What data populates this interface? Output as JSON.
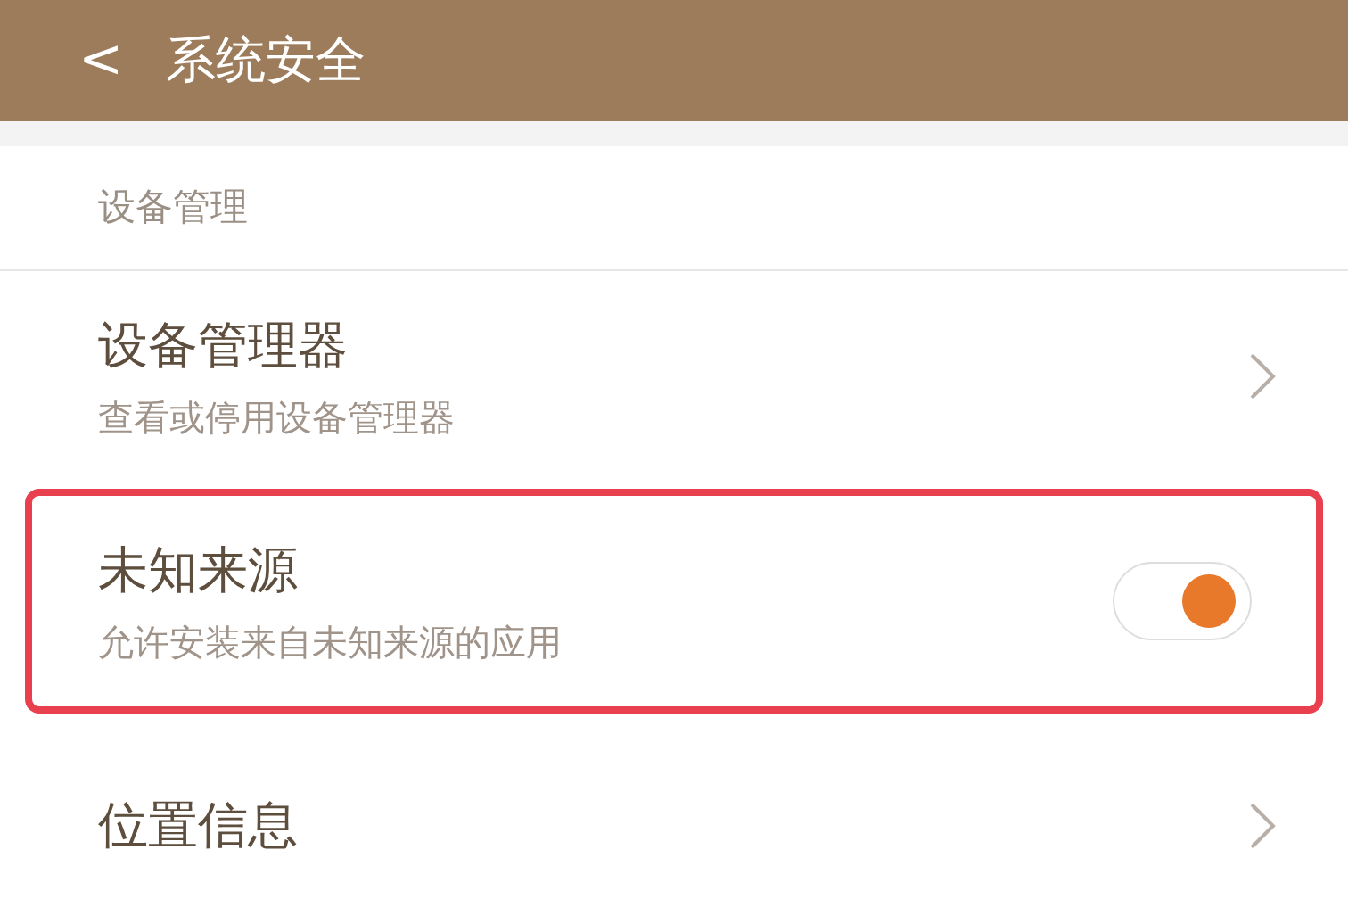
{
  "header": {
    "back": "<",
    "title": "系统安全"
  },
  "section": {
    "title": "设备管理"
  },
  "items": [
    {
      "kind": "link",
      "title": "设备管理器",
      "subtitle": "查看或停用设备管理器",
      "highlighted": false
    },
    {
      "kind": "toggle",
      "title": "未知来源",
      "subtitle": "允许安装来自未知来源的应用",
      "on": true,
      "highlighted": true
    },
    {
      "kind": "link",
      "title": "位置信息",
      "highlighted": false
    }
  ]
}
